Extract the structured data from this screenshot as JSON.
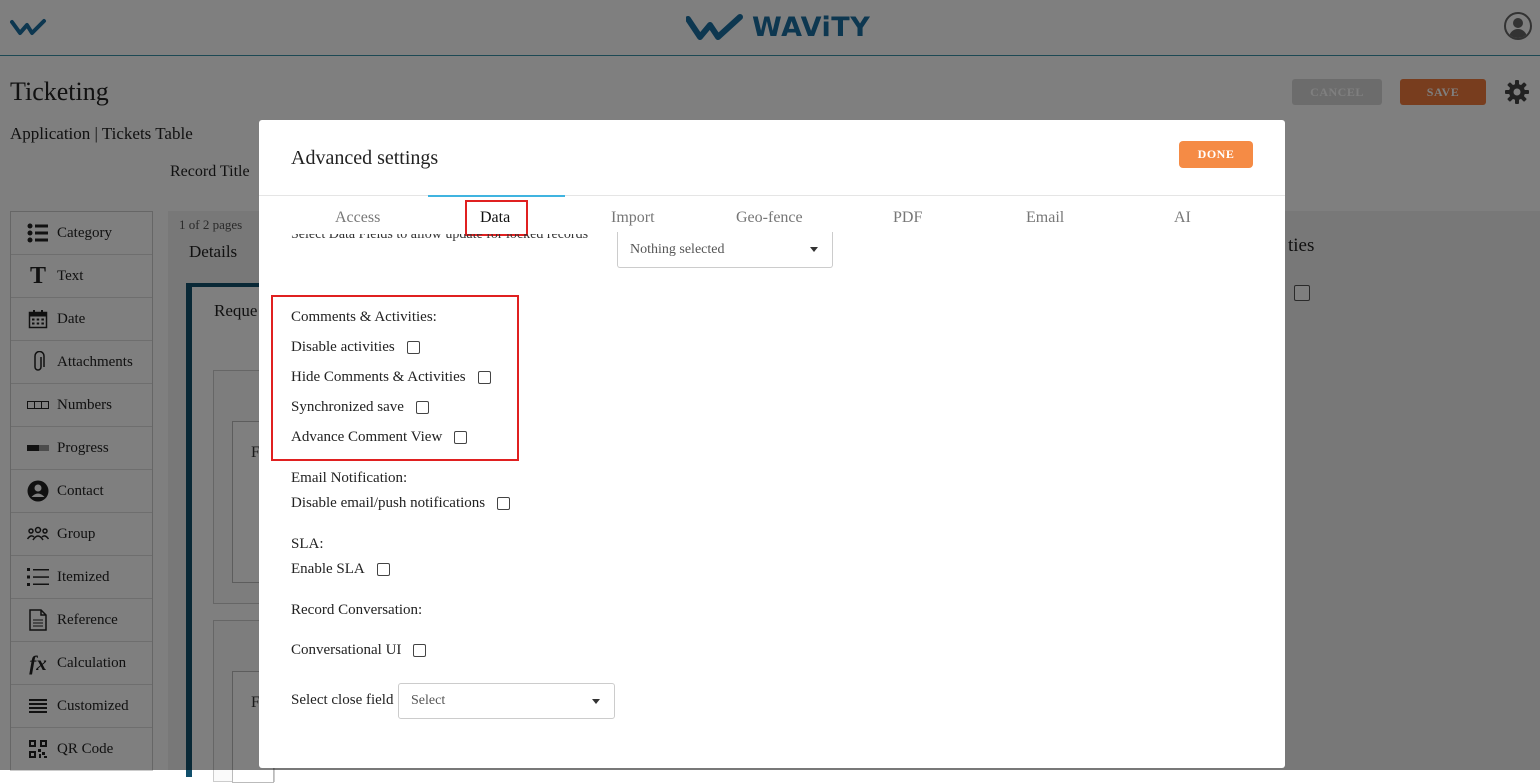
{
  "app": {
    "brand_name": "WAViTY",
    "page_title": "Ticketing",
    "breadcrumb": "Application | Tickets Table",
    "record_title_label": "Record Title",
    "cancel_label": "CANCEL",
    "save_label": "SAVE",
    "pages_label": "1 of 2 pages",
    "details_label": "Details",
    "form_section_partial": "Reque",
    "right_panel_partial": "ties",
    "card_letter": "F"
  },
  "palette": [
    {
      "label": "Category",
      "icon": "list-icon"
    },
    {
      "label": "Text",
      "icon": "text-icon"
    },
    {
      "label": "Date",
      "icon": "calendar-icon"
    },
    {
      "label": "Attachments",
      "icon": "paperclip-icon"
    },
    {
      "label": "Numbers",
      "icon": "numbers-icon"
    },
    {
      "label": "Progress",
      "icon": "progress-icon"
    },
    {
      "label": "Contact",
      "icon": "contact-icon"
    },
    {
      "label": "Group",
      "icon": "group-icon"
    },
    {
      "label": "Itemized",
      "icon": "itemized-icon"
    },
    {
      "label": "Reference",
      "icon": "document-icon"
    },
    {
      "label": "Calculation",
      "icon": "function-icon"
    },
    {
      "label": "Customized",
      "icon": "menu-icon"
    },
    {
      "label": "QR Code",
      "icon": "qr-code-icon"
    }
  ],
  "modal": {
    "title": "Advanced settings",
    "done_label": "DONE",
    "tabs": [
      "Access",
      "Data",
      "Import",
      "Geo-fence",
      "PDF",
      "Email",
      "AI"
    ],
    "active_tab": "Data",
    "locked_fields_label": "Select Data Fields to allow update for locked records",
    "locked_fields_value": "Nothing selected",
    "comments_header": "Comments & Activities:",
    "disable_activities": "Disable activities",
    "hide_comments": "Hide Comments & Activities",
    "synchronized_save": "Synchronized save",
    "advance_comment_view": "Advance Comment View",
    "email_header": "Email Notification:",
    "disable_email": "Disable email/push notifications",
    "sla_header": "SLA:",
    "enable_sla": "Enable SLA",
    "record_conversation_header": "Record Conversation:",
    "conversational_ui": "Conversational UI",
    "close_field_label": "Select close field",
    "close_field_value": "Select"
  },
  "colors": {
    "accent_orange": "#f58b45",
    "brand_blue": "#1a6ea0",
    "highlight_red": "#e02020",
    "tab_underline": "#40b4e0"
  }
}
